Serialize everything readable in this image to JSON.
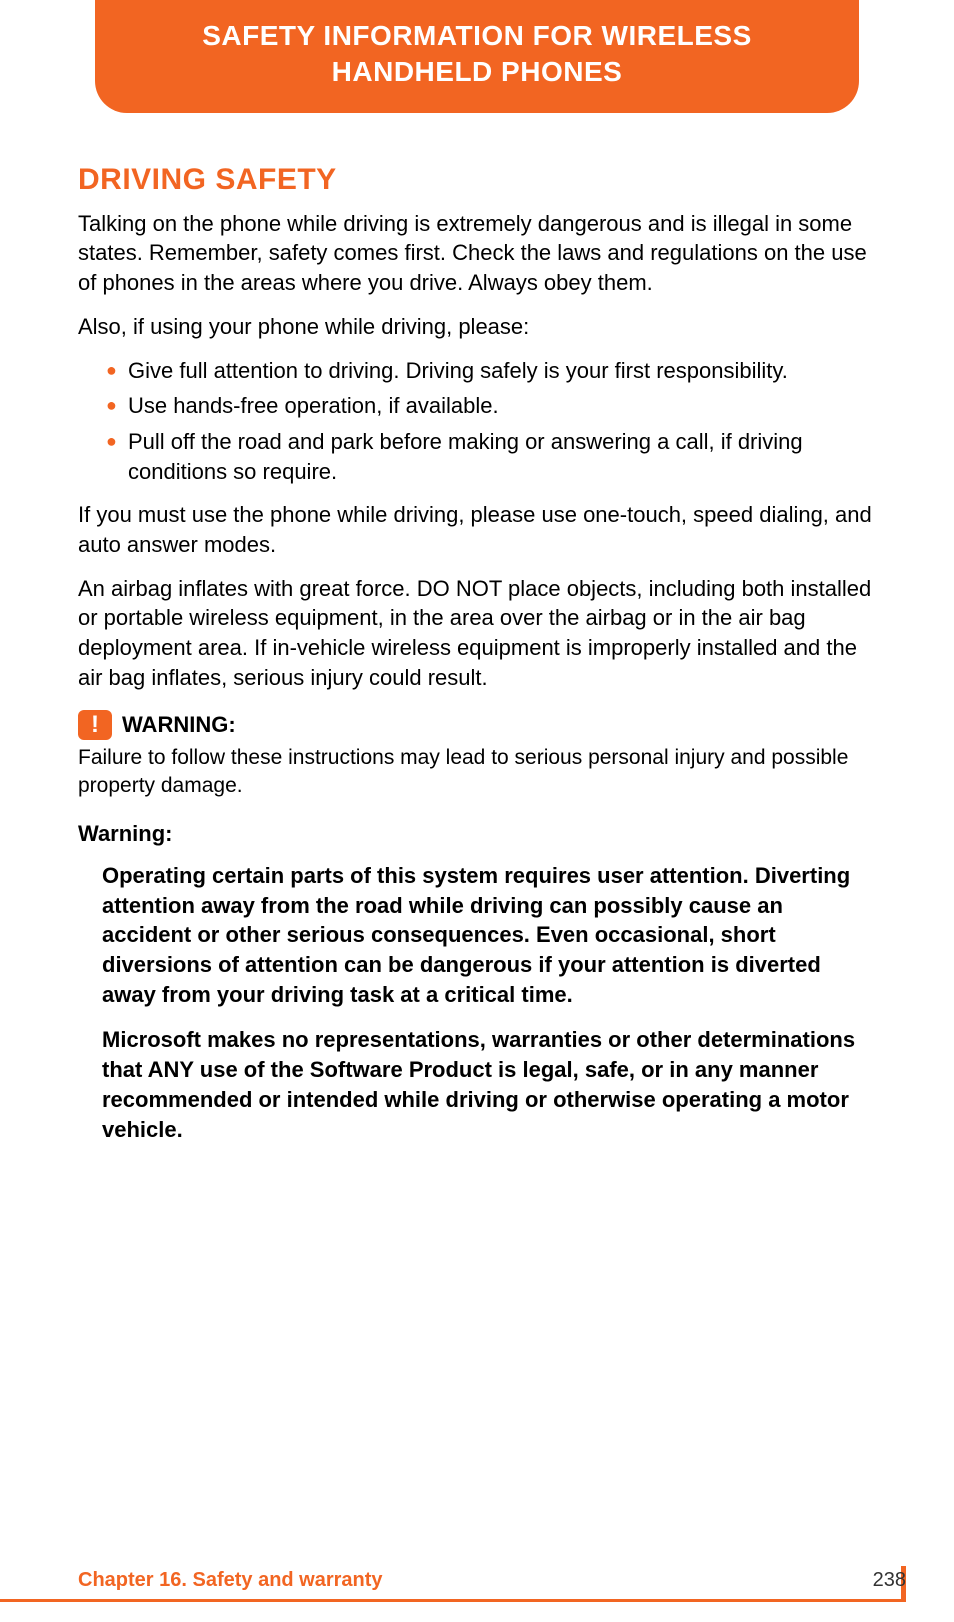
{
  "header": {
    "title": "SAFETY INFORMATION FOR WIRELESS HANDHELD PHONES"
  },
  "section": {
    "heading": "DRIVING SAFETY",
    "para1": "Talking on the phone while driving is extremely dangerous and is illegal in some states. Remember, safety comes first. Check the laws and regulations on the use of phones in the areas where you drive. Always obey them.",
    "para2": "Also, if using your phone while driving, please:",
    "bullets": [
      "Give full attention to driving. Driving safely is your first responsibility.",
      "Use hands-free operation, if available.",
      "Pull off the road and park before making or answering a call, if driving conditions so require."
    ],
    "para3": "If you must use the phone while driving, please use one-touch, speed dialing, and auto answer modes.",
    "para4": "An airbag inflates with great force. DO NOT place objects, including both installed or portable wireless equipment, in the area over the airbag or in the air bag deployment area. If in-vehicle wireless equipment is improperly installed and the air bag inflates, serious injury could result."
  },
  "warning1": {
    "label": "WARNING:",
    "text": "Failure to follow these instructions may lead to serious personal injury and possible property damage."
  },
  "warning2": {
    "heading": "Warning:",
    "bold1": "Operating certain parts of this system requires user attention. Diverting attention away from the road while driving can possibly cause an accident or other serious consequences. Even occasional, short diversions of attention can be dangerous if your attention is diverted away from your driving task at a critical time.",
    "bold2": "Microsoft makes no representations, warranties or other determinations that ANY use of the Software Product is legal, safe, or in any manner recommended or intended while driving or otherwise operating a motor vehicle."
  },
  "footer": {
    "chapter": "Chapter 16. Safety and warranty",
    "page": "238"
  }
}
